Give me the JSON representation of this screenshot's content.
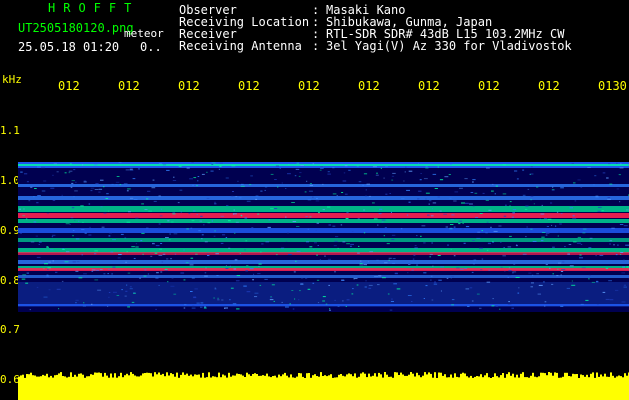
{
  "header": {
    "app_title": "HROFFT",
    "filename": "UT2505180120.png",
    "mode": "meteor",
    "datetime": "25.05.18 01:20",
    "status_code": "0.."
  },
  "info": [
    {
      "label": "Observer",
      "value": "Masaki Kano"
    },
    {
      "label": "Receiving Location",
      "value": "Shibukawa, Gunma, Japan"
    },
    {
      "label": "Receiver",
      "value": "RTL-SDR SDR# 43dB L15 103.2MHz CW"
    },
    {
      "label": "Receiving Antenna",
      "value": "3el Yagi(V) Az 330 for Vladivostok"
    }
  ],
  "separator": ":",
  "axes": {
    "y_unit": "kHz",
    "x_ticks": [
      "012",
      "012",
      "012",
      "012",
      "012",
      "012",
      "012",
      "012",
      "012",
      "0130"
    ],
    "y_ticks": [
      "1.1",
      "1.0",
      "0.9",
      "0.8",
      "0.7",
      "0.6"
    ]
  },
  "colors": {
    "background": "#000000",
    "spectrogram_bg": "#000080",
    "label_yellow": "#ffff00",
    "label_green": "#00ff00",
    "label_white": "#ffffff",
    "band_strong": "#ff2050",
    "band_mid": "#00ffa0",
    "band_weak": "#3080ff"
  }
}
